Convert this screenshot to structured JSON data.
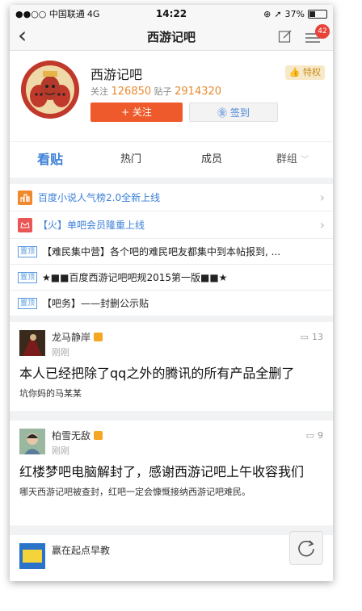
{
  "status_bar": {
    "carrier": "●●○○ 中国联通",
    "network": "4G",
    "time": "14:22",
    "battery": "37%",
    "battery_level": 0.37
  },
  "nav": {
    "title": "西游记吧",
    "badge": "42",
    "icons": [
      "back-chevron-icon",
      "edit-icon",
      "menu-icon"
    ]
  },
  "forum": {
    "name": "西游记吧",
    "follow_label": "关注",
    "follow_count": "126850",
    "post_label": "贴子",
    "post_count": "2914320",
    "follow_button": "+ 关注",
    "sign_button": "签到",
    "privilege": "特权"
  },
  "tabs": [
    {
      "label": "看贴"
    },
    {
      "label": "热门"
    },
    {
      "label": "成员"
    },
    {
      "label": "群组"
    }
  ],
  "notices": [
    {
      "text": "百度小说人气榜2.0全新上线",
      "icon": "chart-icon"
    },
    {
      "text": "【火】单吧会员隆重上线",
      "icon": "crown-icon"
    }
  ],
  "top_tag": "置顶",
  "top_posts": [
    {
      "text": "【难民集中营】各个吧的难民吧友都集中到本帖报到, ..."
    },
    {
      "text": "★■■百度西游记吧吧规2015第一版■■★"
    },
    {
      "text": "【吧务】——封删公示贴"
    }
  ],
  "posts": [
    {
      "user": "龙马静岸",
      "time": "刚刚",
      "comments": "13",
      "title": "本人已经把除了qq之外的腾讯的所有产品全删了",
      "sub": "坑你妈的马某某"
    },
    {
      "user": "柏雪无敌",
      "time": "刚刚",
      "comments": "9",
      "title": "红楼梦吧电脑解封了，感谢西游记吧上午收容我们",
      "sub": "哪天西游记吧被查封，红吧一定会慷慨接纳西游记吧难民。"
    },
    {
      "user": "赢在起点早教"
    }
  ],
  "colors": {
    "accent_blue": "#3c80d8",
    "follow_orange": "#ef5a2c",
    "badge_red": "#e8433a",
    "count_orange": "#e68a2e"
  }
}
